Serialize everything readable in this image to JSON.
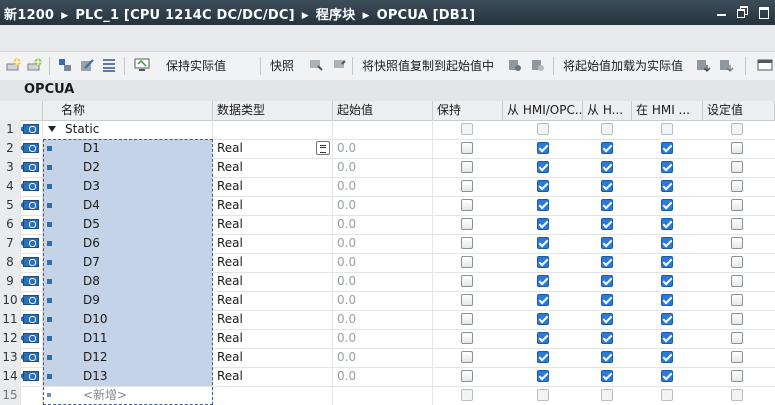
{
  "breadcrumb": [
    "新1200",
    "PLC_1 [CPU 1214C DC/DC/DC]",
    "程序块",
    "OPCUA [DB1]"
  ],
  "toolbar": {
    "keep_actual": "保持实际值",
    "snapshot": "快照",
    "copy_snapshot": "将快照值复制到起始值中",
    "load_start": "将起始值加载为实际值"
  },
  "db_name": "OPCUA",
  "columns": [
    "名称",
    "数据类型",
    "起始值",
    "保持",
    "从 HMI/OPC...",
    "从 H...",
    "在 HMI ...",
    "设定值"
  ],
  "static_row": {
    "num": "1",
    "name": "Static"
  },
  "rows": [
    {
      "num": "2",
      "name": "D1",
      "type": "Real",
      "start": "0.0",
      "retain": false,
      "hmi_opc": true,
      "from_h": true,
      "in_hmi": true,
      "setpoint": false
    },
    {
      "num": "3",
      "name": "D2",
      "type": "Real",
      "start": "0.0",
      "retain": false,
      "hmi_opc": true,
      "from_h": true,
      "in_hmi": true,
      "setpoint": false
    },
    {
      "num": "4",
      "name": "D3",
      "type": "Real",
      "start": "0.0",
      "retain": false,
      "hmi_opc": true,
      "from_h": true,
      "in_hmi": true,
      "setpoint": false
    },
    {
      "num": "5",
      "name": "D4",
      "type": "Real",
      "start": "0.0",
      "retain": false,
      "hmi_opc": true,
      "from_h": true,
      "in_hmi": true,
      "setpoint": false
    },
    {
      "num": "6",
      "name": "D5",
      "type": "Real",
      "start": "0.0",
      "retain": false,
      "hmi_opc": true,
      "from_h": true,
      "in_hmi": true,
      "setpoint": false
    },
    {
      "num": "7",
      "name": "D6",
      "type": "Real",
      "start": "0.0",
      "retain": false,
      "hmi_opc": true,
      "from_h": true,
      "in_hmi": true,
      "setpoint": false
    },
    {
      "num": "8",
      "name": "D7",
      "type": "Real",
      "start": "0.0",
      "retain": false,
      "hmi_opc": true,
      "from_h": true,
      "in_hmi": true,
      "setpoint": false
    },
    {
      "num": "9",
      "name": "D8",
      "type": "Real",
      "start": "0.0",
      "retain": false,
      "hmi_opc": true,
      "from_h": true,
      "in_hmi": true,
      "setpoint": false
    },
    {
      "num": "10",
      "name": "D9",
      "type": "Real",
      "start": "0.0",
      "retain": false,
      "hmi_opc": true,
      "from_h": true,
      "in_hmi": true,
      "setpoint": false
    },
    {
      "num": "11",
      "name": "D10",
      "type": "Real",
      "start": "0.0",
      "retain": false,
      "hmi_opc": true,
      "from_h": true,
      "in_hmi": true,
      "setpoint": false
    },
    {
      "num": "12",
      "name": "D11",
      "type": "Real",
      "start": "0.0",
      "retain": false,
      "hmi_opc": true,
      "from_h": true,
      "in_hmi": true,
      "setpoint": false
    },
    {
      "num": "13",
      "name": "D12",
      "type": "Real",
      "start": "0.0",
      "retain": false,
      "hmi_opc": true,
      "from_h": true,
      "in_hmi": true,
      "setpoint": false
    },
    {
      "num": "14",
      "name": "D13",
      "type": "Real",
      "start": "0.0",
      "retain": false,
      "hmi_opc": true,
      "from_h": true,
      "in_hmi": true,
      "setpoint": false
    }
  ],
  "new_row": {
    "num": "15",
    "name": "<新增>"
  },
  "icons": [
    "add-row-icon",
    "insert-row-icon",
    "expand-icon",
    "edit-icon",
    "collapse-all-icon",
    "monitor-icon",
    "snapshot-download-icon",
    "snapshot-upload-icon",
    "copy-icon",
    "paste-icon",
    "load-icon",
    "load-all-icon",
    "window-icon"
  ],
  "colors": {
    "accent": "#2c7ad8",
    "title_bg": "#2c3944",
    "selection": "#c4d3e8"
  }
}
